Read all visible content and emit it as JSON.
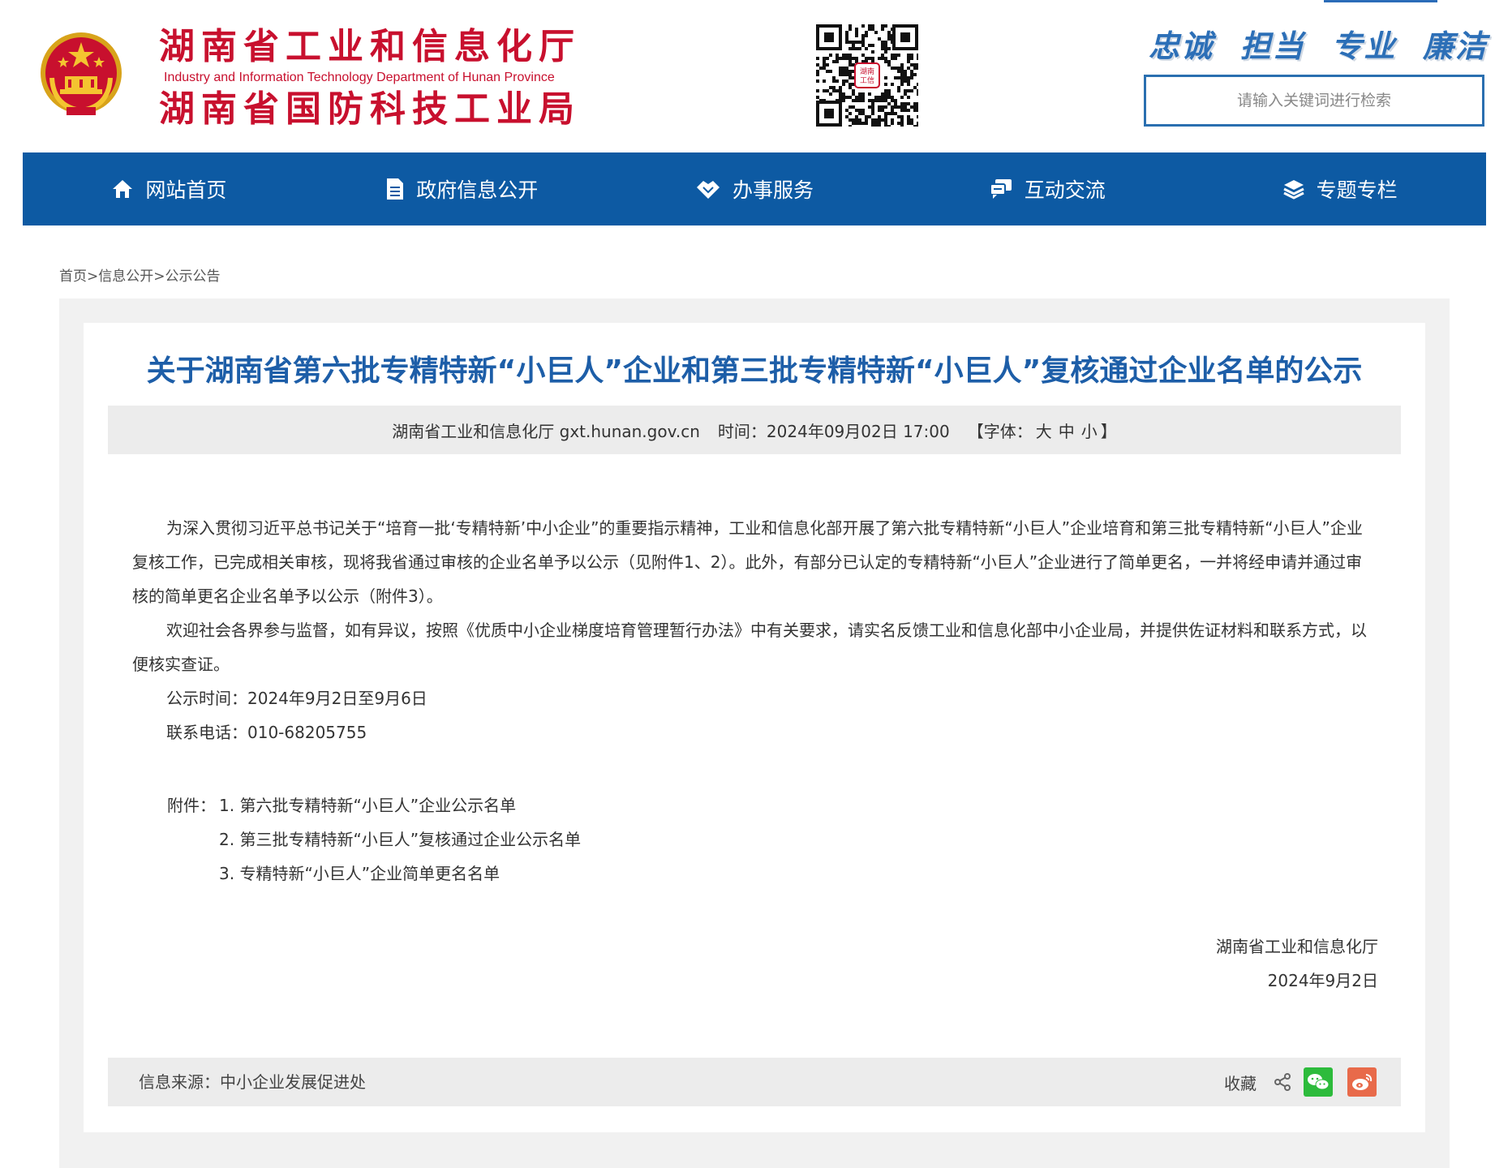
{
  "header": {
    "title_cn_1": "湖南省工业和信息化厅",
    "title_en": "Industry and Information Technology Department of Hunan Province",
    "title_cn_2": "湖南省国防科技工业局",
    "slogans": [
      "忠诚",
      "担当",
      "专业",
      "廉洁"
    ],
    "search_placeholder": "请输入关键词进行检索",
    "qrcode_text": "湖南工信"
  },
  "nav": {
    "items": [
      {
        "label": "网站首页",
        "icon": "home-icon"
      },
      {
        "label": "政府信息公开",
        "icon": "document-icon"
      },
      {
        "label": "办事服务",
        "icon": "handshake-icon"
      },
      {
        "label": "互动交流",
        "icon": "chat-icon"
      },
      {
        "label": "专题专栏",
        "icon": "layers-icon"
      }
    ]
  },
  "breadcrumb": {
    "text": "首页>信息公开>公示公告"
  },
  "article": {
    "title": "关于湖南省第六批专精特新“小巨人”企业和第三批专精特新“小巨人”复核通过企业名单的公示",
    "meta": {
      "source": "湖南省工业和信息化厅 gxt.hunan.gov.cn",
      "time": "时间：2024年09月02日 17:00",
      "font_prefix": "【字体：",
      "font_large": "大",
      "font_medium": "中",
      "font_small": "小",
      "font_suffix": "】"
    },
    "paragraphs": [
      "为深入贯彻习近平总书记关于“培育一批‘专精特新’中小企业”的重要指示精神，工业和信息化部开展了第六批专精特新“小巨人”企业培育和第三批专精特新“小巨人”企业复核工作，已完成相关审核，现将我省通过审核的企业名单予以公示（见附件1、2）。此外，有部分已认定的专精特新“小巨人”企业进行了简单更名，一并将经申请并通过审核的简单更名企业名单予以公示（附件3）。",
      "欢迎社会各界参与监督，如有异议，按照《优质中小企业梯度培育管理暂行办法》中有关要求，请实名反馈工业和信息化部中小企业局，并提供佐证材料和联系方式，以便核实查证。",
      "公示时间：2024年9月2日至9月6日",
      "联系电话：010-68205755"
    ],
    "attachments_label": "附件：",
    "attachments": [
      "1. 第六批专精特新“小巨人”企业公示名单",
      "2. 第三批专精特新“小巨人”复核通过企业公示名单",
      "3. 专精特新“小巨人”企业简单更名名单"
    ],
    "signature_org": "湖南省工业和信息化厅",
    "signature_date": "2024年9月2日",
    "info_source": "信息来源：中小企业发展促进处",
    "collect_label": "收藏"
  },
  "colors": {
    "brand_red": "#c8102e",
    "nav_blue": "#0d5aa3",
    "title_blue": "#1d5ea8",
    "wechat_green": "#2dbb3c",
    "weibo_orange": "#e86a4a"
  }
}
